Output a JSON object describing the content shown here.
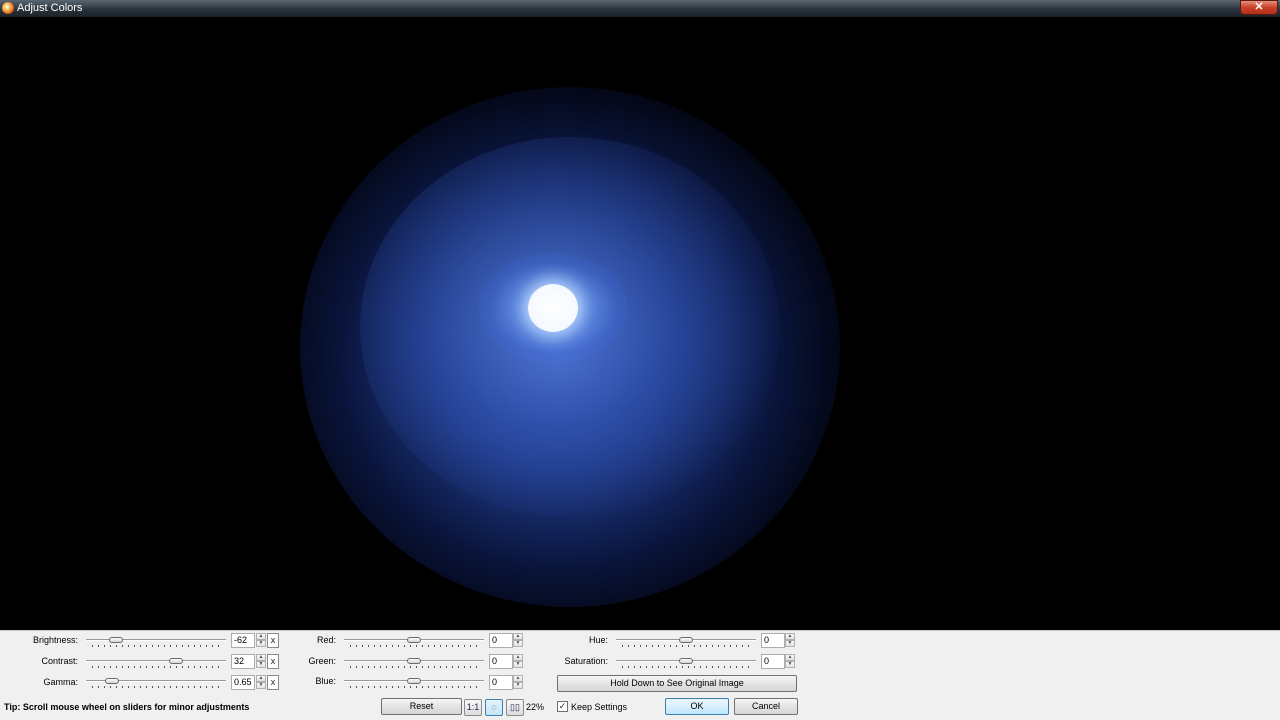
{
  "window": {
    "title": "Adjust Colors",
    "close_glyph": "✕"
  },
  "adjustments": {
    "brightness": {
      "label": "Brightness:",
      "value": "-62",
      "level": -0.62
    },
    "contrast": {
      "label": "Contrast:",
      "value": "32",
      "level": 0.32
    },
    "gamma": {
      "label": "Gamma:",
      "value": "0.65",
      "level": -0.68
    },
    "red": {
      "label": "Red:",
      "value": "0",
      "level": 0
    },
    "green": {
      "label": "Green:",
      "value": "0",
      "level": 0
    },
    "blue": {
      "label": "Blue:",
      "value": "0",
      "level": 0
    },
    "hue": {
      "label": "Hue:",
      "value": "0",
      "level": 0
    },
    "saturation": {
      "label": "Saturation:",
      "value": "0",
      "level": 0
    }
  },
  "reset_x": "x",
  "buttons": {
    "hold_original": "Hold Down to See Original Image",
    "reset": "Reset",
    "one_to_one": "1:1",
    "ok": "OK",
    "cancel": "Cancel"
  },
  "icons": {
    "fit": "fit-window-icon",
    "split": "split-view-icon",
    "fit_glyph": "◌",
    "split_glyph": "▯▯",
    "check_glyph": "✓"
  },
  "zoom": "22%",
  "keep_settings": {
    "label": "Keep Settings",
    "checked": true
  },
  "tip": "Tip: Scroll mouse wheel on sliders for minor adjustments"
}
